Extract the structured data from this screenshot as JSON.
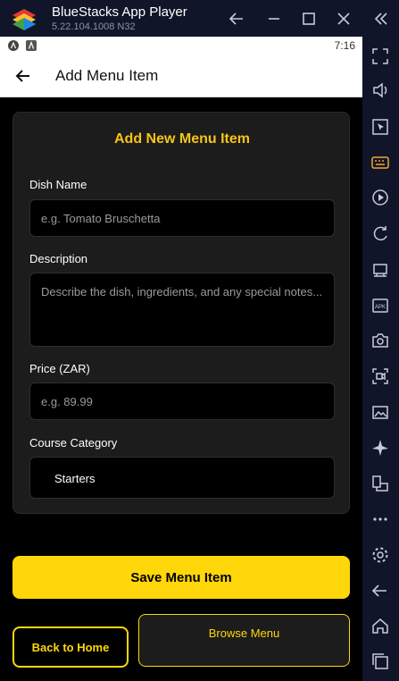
{
  "window": {
    "title": "BlueStacks App Player",
    "version": "5.22.104.1008  N32"
  },
  "android": {
    "time": "7:16"
  },
  "appbar": {
    "title": "Add Menu Item"
  },
  "form": {
    "heading": "Add New Menu Item",
    "dish_name_label": "Dish Name",
    "dish_name_placeholder": "e.g. Tomato Bruschetta",
    "description_label": "Description",
    "description_placeholder": "Describe the dish, ingredients, and any special notes...",
    "price_label": "Price (ZAR)",
    "price_placeholder": "e.g. 89.99",
    "category_label": "Course Category",
    "category_selected": "Starters"
  },
  "actions": {
    "save_label": "Save Menu Item",
    "home_label": "Back to Home",
    "browse_label": "Browse Menu"
  },
  "colors": {
    "accent": "#ffd60a",
    "card_bg": "#1c1c1c",
    "emulator_chrome": "#10152a"
  }
}
